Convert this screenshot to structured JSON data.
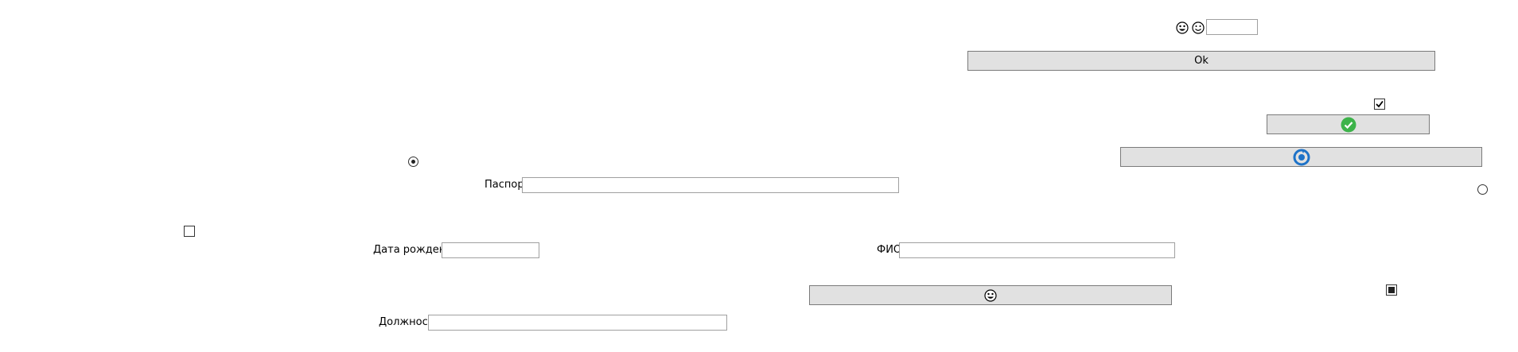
{
  "labels": {
    "passport": "Паспорт",
    "birth_date": "Дата рождения",
    "full_name": "ФИО",
    "position": "Должность"
  },
  "fields": {
    "top_small": "",
    "passport": "",
    "birth_date": "",
    "full_name": "",
    "position": ""
  },
  "buttons": {
    "ok": "Ok"
  },
  "icons": {
    "top_left": "grinning-face-icon",
    "top_right": "smiling-face-icon",
    "check_button": "green-check-circle-icon",
    "blue_button": "blue-refresh-icon",
    "bottom_button": "grinning-face-icon"
  },
  "colors": {
    "button_bg": "#e1e1e1",
    "green": "#3db34a",
    "blue": "#1e73c8"
  }
}
